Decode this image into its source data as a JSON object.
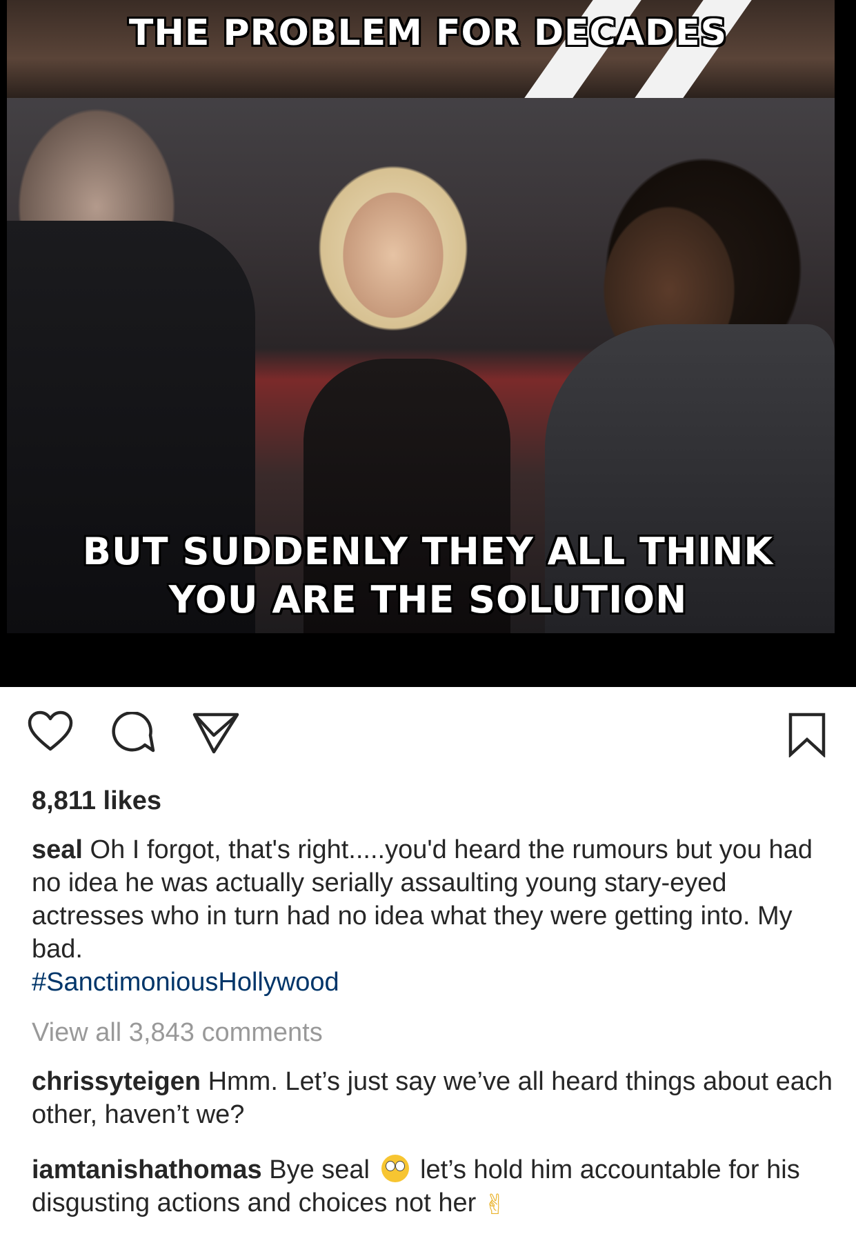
{
  "post": {
    "image": {
      "top_text": "THE PROBLEM FOR DECADES",
      "bottom_text_line1": "BUT SUDDENLY THEY ALL THINK",
      "bottom_text_line2": "YOU ARE THE SOLUTION"
    },
    "actions": {
      "icons": [
        "heart-icon",
        "comment-icon",
        "share-icon",
        "bookmark-icon"
      ]
    },
    "likes": "8,811 likes",
    "caption": {
      "username": "seal",
      "text": "Oh I forgot, that's right.....you'd heard the rumours but you had no idea he was actually serially assaulting young stary-eyed actresses who in turn had no idea what they were getting into. My bad.",
      "hashtag": "#SanctimoniousHollywood"
    },
    "view_all_comments": "View all 3,843 comments",
    "comments": [
      {
        "username": "chrissyteigen",
        "text": "Hmm. Let’s just say we’ve all heard things about each other, haven’t we?"
      },
      {
        "username": "iamtanishathomas",
        "text_before_emoji": "Bye seal",
        "emoji_1": "rolling-eyes-emoji",
        "text_after_emoji": "let’s hold him accountable for his disgusting actions and choices not her",
        "emoji_2": "victory-hand-emoji"
      }
    ]
  },
  "colors": {
    "text": "#262626",
    "hashtag": "#003569",
    "muted": "#999999"
  }
}
